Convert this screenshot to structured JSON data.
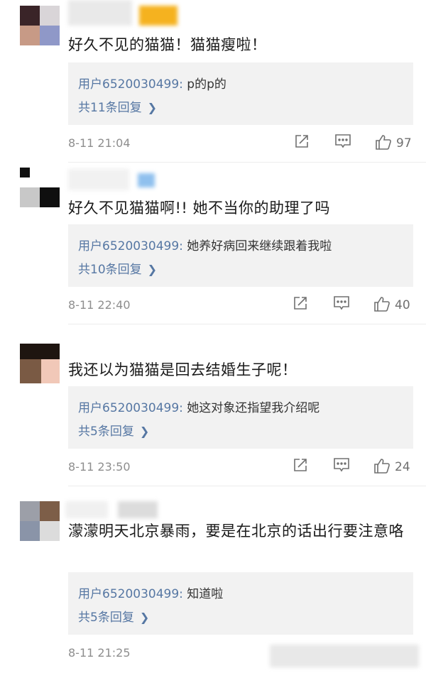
{
  "comments": [
    {
      "text": "好久不见的猫猫！猫猫瘦啦！",
      "reply_user": "用户6520030499:",
      "reply_text": " p的p的",
      "reply_more": "共11条回复",
      "time": "8-11 21:04",
      "likes": "97"
    },
    {
      "text": "好久不见猫猫啊!! 她不当你的助理了吗",
      "reply_user": "用户6520030499:",
      "reply_text": " 她养好病回来继续跟着我啦",
      "reply_more": "共10条回复",
      "time": "8-11 22:40",
      "likes": "40"
    },
    {
      "text": "我还以为猫猫是回去结婚生子呢！",
      "reply_user": "用户6520030499:",
      "reply_text": " 她这对象还指望我介绍呢",
      "reply_more": "共5条回复",
      "time": "8-11 23:50",
      "likes": "24"
    },
    {
      "text": "濛濛明天北京暴雨，要是在北京的话出行要注意咯",
      "reply_user": "用户6520030499:",
      "reply_text": " 知道啦",
      "reply_more": "共5条回复",
      "time": "8-11 21:25"
    }
  ],
  "icons": {
    "repost": "share-icon",
    "comment": "comment-icon",
    "like": "thumb-up-icon",
    "chevron": "chevron-right-icon"
  },
  "colors": {
    "accent_link": "#5677a3",
    "reply_bg": "#f2f2f2",
    "meta_gray": "#8e8e8e"
  }
}
